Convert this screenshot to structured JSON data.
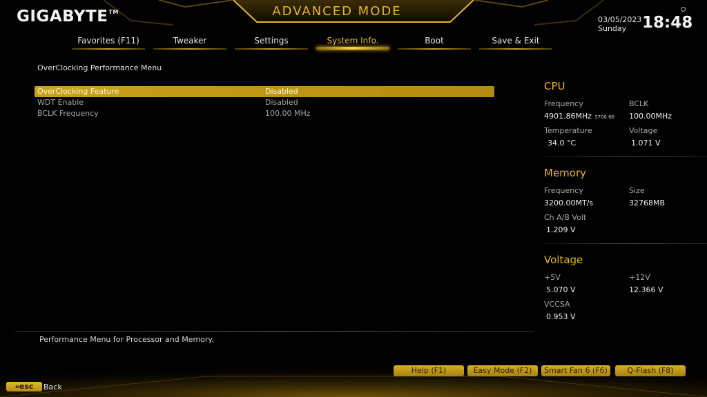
{
  "header": {
    "brand": "GIGABYTE",
    "brand_tm": "TM",
    "mode_title": "ADVANCED MODE",
    "date": "03/05/2023",
    "weekday": "Sunday",
    "time": "18:48"
  },
  "tabs": [
    {
      "label": "Favorites (F11)",
      "active": false
    },
    {
      "label": "Tweaker",
      "active": false
    },
    {
      "label": "Settings",
      "active": false
    },
    {
      "label": "System Info.",
      "active": true
    },
    {
      "label": "Boot",
      "active": false
    },
    {
      "label": "Save & Exit",
      "active": false
    }
  ],
  "main": {
    "section_title": "OverClocking Performance Menu",
    "rows": [
      {
        "label": "OverClocking Feature",
        "value": "Disabled",
        "selected": true
      },
      {
        "label": "WDT Enable",
        "value": "Disabled",
        "selected": false
      },
      {
        "label": "BCLK Frequency",
        "value": "100.00 MHz",
        "selected": false
      }
    ],
    "help_text": "Performance Menu for Processor and Memory."
  },
  "cpu": {
    "title": "CPU",
    "frequency_label": "Frequency",
    "frequency_value": "4901.86MHz",
    "frequency_sub": "3700.66",
    "bclk_label": "BCLK",
    "bclk_value": "100.00MHz",
    "temperature_label": "Temperature",
    "temperature_value": "34.0 °C",
    "voltage_label": "Voltage",
    "voltage_value": "1.071 V"
  },
  "memory": {
    "title": "Memory",
    "frequency_label": "Frequency",
    "frequency_value": "3200.00MT/s",
    "size_label": "Size",
    "size_value": "32768MB",
    "volt_label": "Ch A/B Volt",
    "volt_value": "1.209 V"
  },
  "voltage": {
    "title": "Voltage",
    "v5_label": "+5V",
    "v5_value": "5.070 V",
    "v12_label": "+12V",
    "v12_value": "12.366 V",
    "vccsa_label": "VCCSA",
    "vccsa_value": "0.953 V"
  },
  "footer": {
    "buttons": [
      "Help (F1)",
      "Easy Mode (F2)",
      "Smart Fan 6 (F6)",
      "Q-Flash (F8)"
    ],
    "esc_label": "esc",
    "back_label": "Back"
  },
  "colors": {
    "accent": "#e8b81c",
    "selected_row": "#c9a21c",
    "background": "#000000"
  }
}
